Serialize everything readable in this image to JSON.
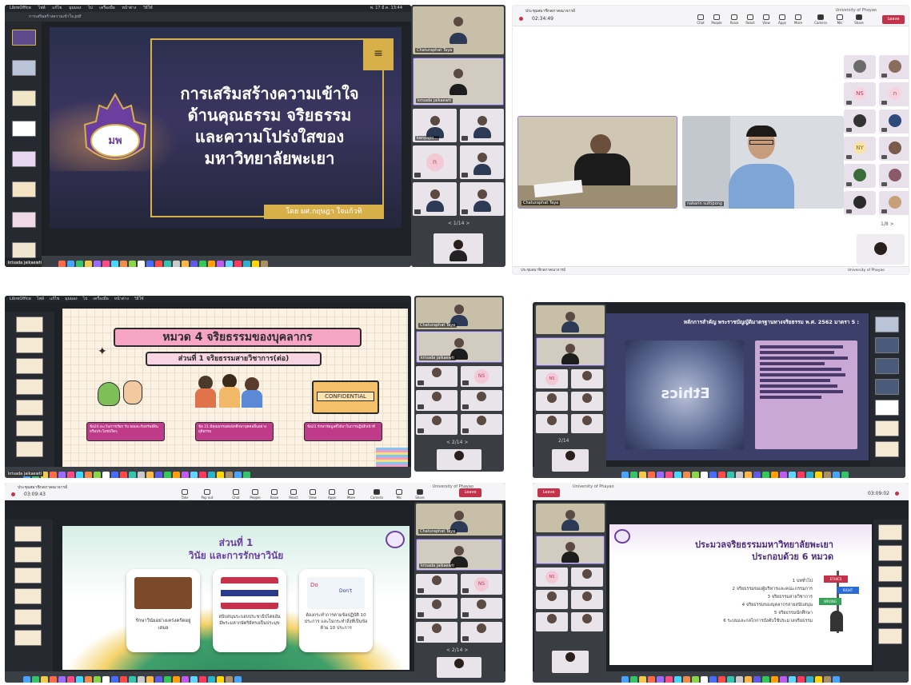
{
  "panel1": {
    "menubar": [
      "LibreOffice",
      "ไฟล์",
      "แก้ไข",
      "มุมมอง",
      "ไป",
      "เครื่องมือ",
      "หน้าต่าง",
      "วิธีใช้"
    ],
    "menubar_right": "พ. 17 มี.ค. 13:44",
    "file_title": "การเสริมสร้างความเข้าใจ.pdf",
    "slide_title_lines": [
      "การเสริมสร้างความเข้าใจ",
      "ด้านคุณธรรม จริยธรรม",
      "และความโปร่งใสของ",
      "มหาวิทยาลัยพะเยา"
    ],
    "presenter": "โดย ผศ.กฤษฎา ใจแก้วทิ",
    "logo_text": "มหาวิทยาลัยพะเยา",
    "participants": [
      "Chaturaphat Taya",
      "krisada jaikaewti",
      "kanyapo...",
      "n"
    ],
    "pager": "< 1/14 >",
    "local_user": "krisada jaikaewti"
  },
  "panel2": {
    "window_title": "ประชุมสมาชิกสภาคณาจารย์",
    "org": "University of Phayao",
    "timer": "02:34:49",
    "toolbar": [
      "Chat",
      "People",
      "Raise",
      "React",
      "View",
      "Apps",
      "More",
      "Camera",
      "Mic",
      "Share"
    ],
    "people_count": "148",
    "leave": "Leave",
    "speaker_left": "Chaturaphat Taya",
    "speaker_right": "nakarin suttipong",
    "initials": [
      "NS",
      "n",
      "NY"
    ],
    "pager": "1/8 >",
    "bottom_title": "ประชุมสมาชิกสภาคณาจารย์",
    "bottom_org": "University of Phayao"
  },
  "panel3": {
    "slide_title": "หมวด 4 จริยธรรมของบุคลากร",
    "slide_subtitle": "ส่วนที่ 1 จริยธรรมสายวิชาการ(ต่อ)",
    "confidential": "CONFIDENTIAL",
    "box1": "ข้อ20.ละเว้นการเรียก รับ ยอมจะรับทรัพย์สินหรือประโยชน์ใดๆ",
    "box2": "ข้อ 21.มีคุณธรรมต่อนักศึกษาบุคคลอื่นอย่างยุติธรรม",
    "box3": "ข้อ22.รักษาข้อมูลที่ได้มาในการปฏิบัติหน้าที่",
    "participants": [
      "Chaturaphat Taya",
      "krisada jaikaewti"
    ],
    "initials": "NS",
    "pager": "< 2/14 >",
    "local_user": "krisada jaikaewti"
  },
  "panel4": {
    "slide_header": "หลักการสำคัญ พระราชบัญญัติมาตรฐานทางจริยธรรม พ.ศ. 2562 มาตรา 5 :",
    "ethics_word": "Ethics",
    "pager": "2/14",
    "initials": "NS"
  },
  "panel5": {
    "window_title": "ประชุมสมาชิกสภาคณาจารย์",
    "org": "University of Phayao",
    "timer": "03:09:43",
    "toolbar": [
      "Take control",
      "Pop out",
      "Chat",
      "People",
      "Raise",
      "React",
      "View",
      "Apps",
      "More",
      "Camera",
      "Mic",
      "Share"
    ],
    "people_count": "142",
    "leave": "Leave",
    "slide_title": "ส่วนที่ 1",
    "slide_subtitle": "วินัย และการรักษาวินัย",
    "card1": "รักษาวินัยอย่างเคร่งครัดอยู่เสมอ",
    "card2": "สนับสนุนระบอบประชาธิปไตยอันมีพระมหากษัตริย์ทรงเป็นประมุข",
    "card3": "ต้องกระทำการตามข้อปฏิบัติ 10 ประการ และไม่กระทำสิ่งที่เป็นข้อห้าม 10 ประการ",
    "do_label": "Do",
    "dont_label": "Don't",
    "participants": [
      "Chaturaphat Taya",
      "krisada jaikaewti"
    ],
    "initials": "NS",
    "pager": "< 2/14 >"
  },
  "panel6": {
    "timer": "03:09:02",
    "slide_title_lines": [
      "ประมวลจริยธรรมมหาวิทยาลัยพะเยา",
      "ประกอบด้วย 6 หมวด"
    ],
    "items": [
      "1  บททั่วไป",
      "2  จริยธรรมของผู้บริหารและคณะกรรมการ",
      "3  จริยธรรมสายวิชาการ",
      "4  จริยธรรมของบุคลากรสายสนับสนุน",
      "5  จริยธรรมนักศึกษา",
      "6  ระบบและกลไกการบังคับใช้ประมวลจริยธรรม"
    ],
    "sign_labels": [
      "ETHICS",
      "RIGHT",
      "WRONG"
    ],
    "initials": "NS",
    "leave": "Leave",
    "org": "University of Phayao"
  }
}
